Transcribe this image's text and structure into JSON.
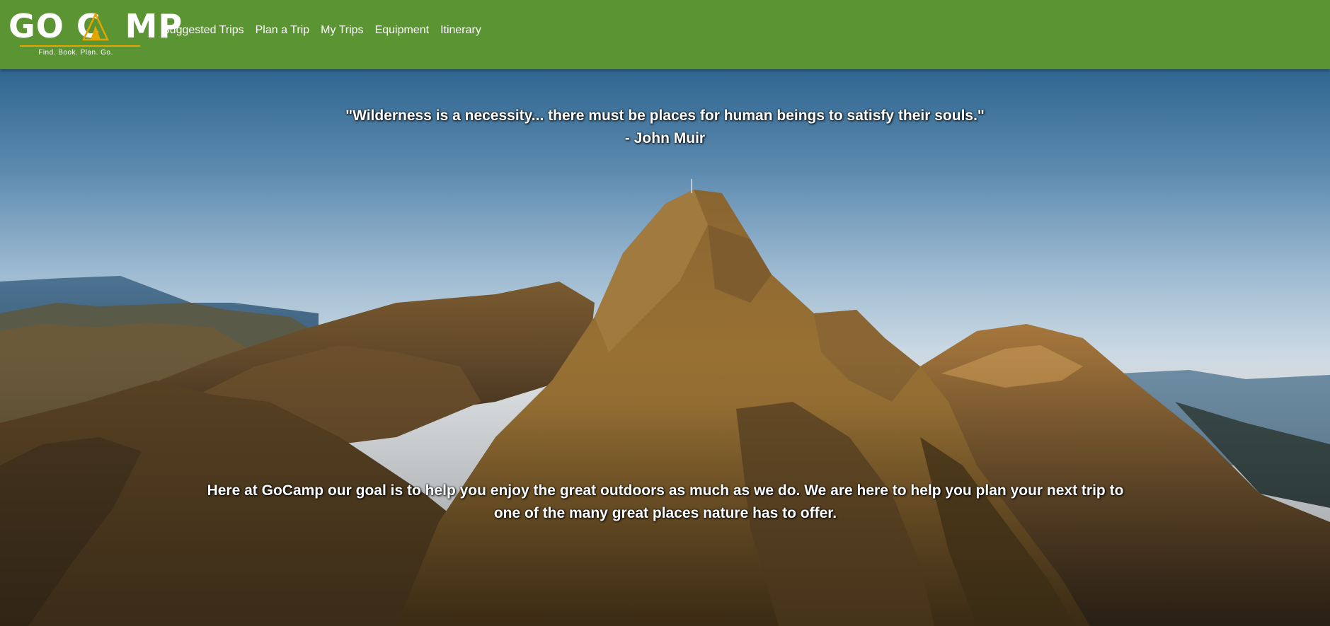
{
  "brand": {
    "logo_text": "GO CAMP",
    "tagline": "Find. Book. Plan. Go.",
    "color": "#5b9432",
    "accent": "#e6a400"
  },
  "nav": {
    "items": [
      {
        "label": "Suggested Trips"
      },
      {
        "label": "Plan a Trip"
      },
      {
        "label": "My Trips"
      },
      {
        "label": "Equipment"
      },
      {
        "label": "Itinerary"
      }
    ]
  },
  "hero": {
    "quote": "\"Wilderness is a necessity... there must be places for human beings to satisfy their souls.\"",
    "quote_author": "- John Muir",
    "mission": "Here at GoCamp our goal is to help you enjoy the great outdoors as much as we do. We are here to help you plan your next trip to one of the many great places nature has to offer.",
    "image": "mountain-ridge-landscape"
  }
}
